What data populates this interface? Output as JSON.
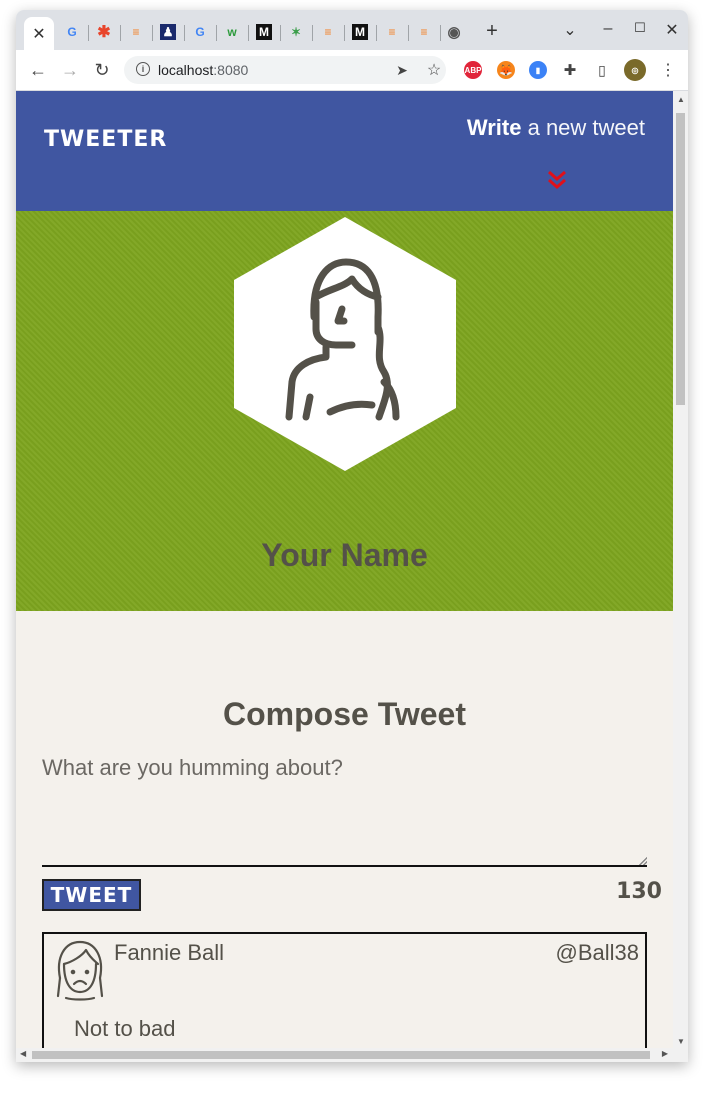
{
  "browser": {
    "active_tab_close": "✕",
    "new_tab": "+",
    "tab_list": "⌄",
    "window_controls": [
      "–",
      "☐",
      "✕"
    ],
    "back": "←",
    "forward": "→",
    "reload": "↻",
    "url_host": "localhost",
    "url_port": ":8080",
    "ext_abp": "ABP"
  },
  "nav": {
    "brand": "TWEETER",
    "write_bold": "Write",
    "write_rest": " a new tweet"
  },
  "profile": {
    "name": "Your Name"
  },
  "compose": {
    "title": "Compose Tweet",
    "placeholder": "What are you humming about?",
    "button": "TWEET",
    "counter": "130"
  },
  "tweets": [
    {
      "name": "Fannie Ball",
      "handle": "@Ball38",
      "text": "Not to bad"
    }
  ],
  "colors": {
    "nav": "#4056a1",
    "header": "#7ea51f",
    "accent_red": "#e0101a",
    "page_bg": "#f4f1ec",
    "text": "#545149"
  }
}
